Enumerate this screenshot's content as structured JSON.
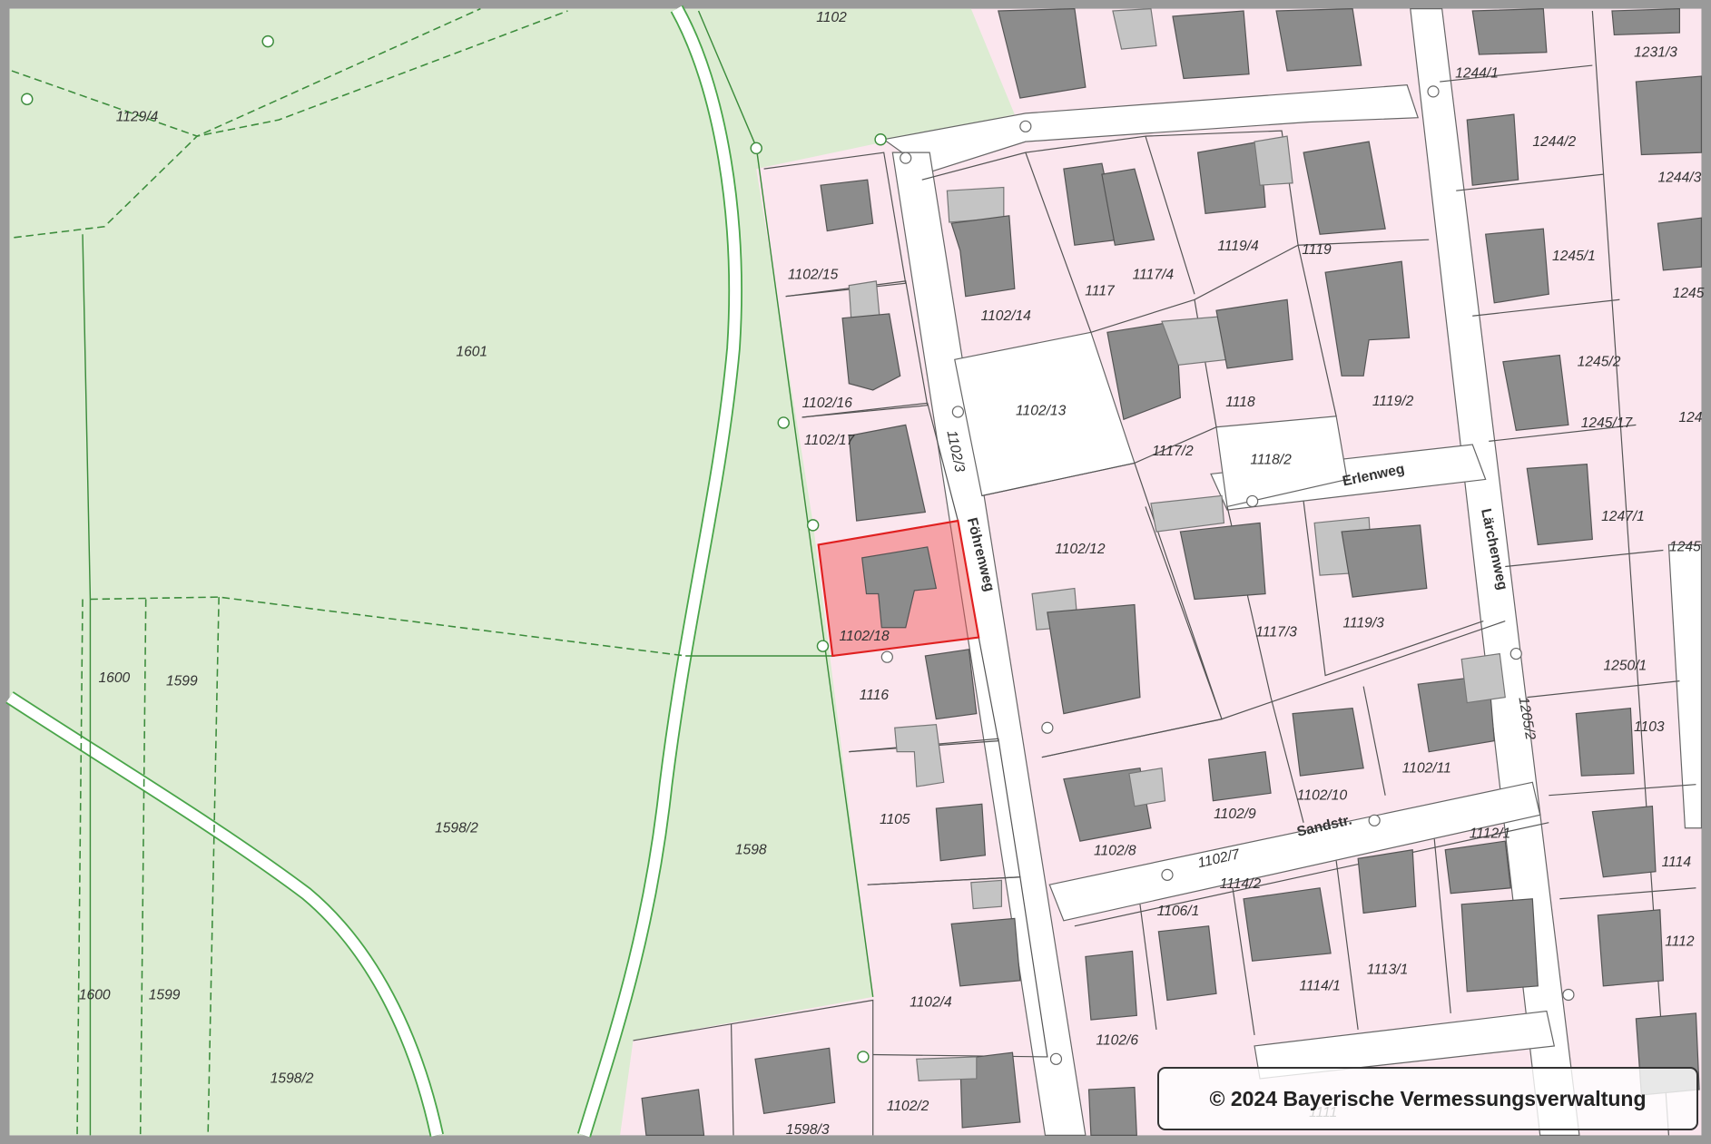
{
  "map": {
    "colors": {
      "green": "#dcecd2",
      "pink": "#fbe6ee",
      "road": "#ffffff",
      "selected": "#f07878",
      "frame": "#9a9a9a"
    },
    "selected_parcel": "1102/18",
    "parcels": [
      "1102",
      "1129/4",
      "1601",
      "1600",
      "1599",
      "1598/2",
      "1598",
      "1600",
      "1599",
      "1598/2",
      "1598/3",
      "1102/15",
      "1102/16",
      "1102/17",
      "1102/18",
      "1116",
      "1105",
      "1102/4",
      "1102/2",
      "1102/14",
      "1117",
      "1117/4",
      "1119/4",
      "1119",
      "1244/1",
      "1231/3",
      "1244/2",
      "1244/3",
      "1245/1",
      "1245",
      "1245/2",
      "1245/17",
      "124",
      "1247/1",
      "1245",
      "1250/1",
      "1103",
      "1114",
      "1112",
      "1102/13",
      "1118",
      "1119/2",
      "1117/2",
      "1118/2",
      "1102/12",
      "1117/3",
      "1119/3",
      "1102/11",
      "1102/10",
      "1102/9",
      "1102/8",
      "1112/1",
      "1114/2",
      "1106/1",
      "1114/1",
      "1113/1",
      "1102/6",
      "1111"
    ],
    "streets": {
      "foehrenweg": "Föhrenweg",
      "foehrenweg_no": "1102/3",
      "erlenweg": "Erlenweg",
      "laerchenweg": "Lärchenweg",
      "laerchenweg_no": "1205/2",
      "sandstr": "Sandstr.",
      "sandstr_no": "1102/7"
    }
  },
  "copyright": "© 2024 Bayerische Vermessungsverwaltung"
}
